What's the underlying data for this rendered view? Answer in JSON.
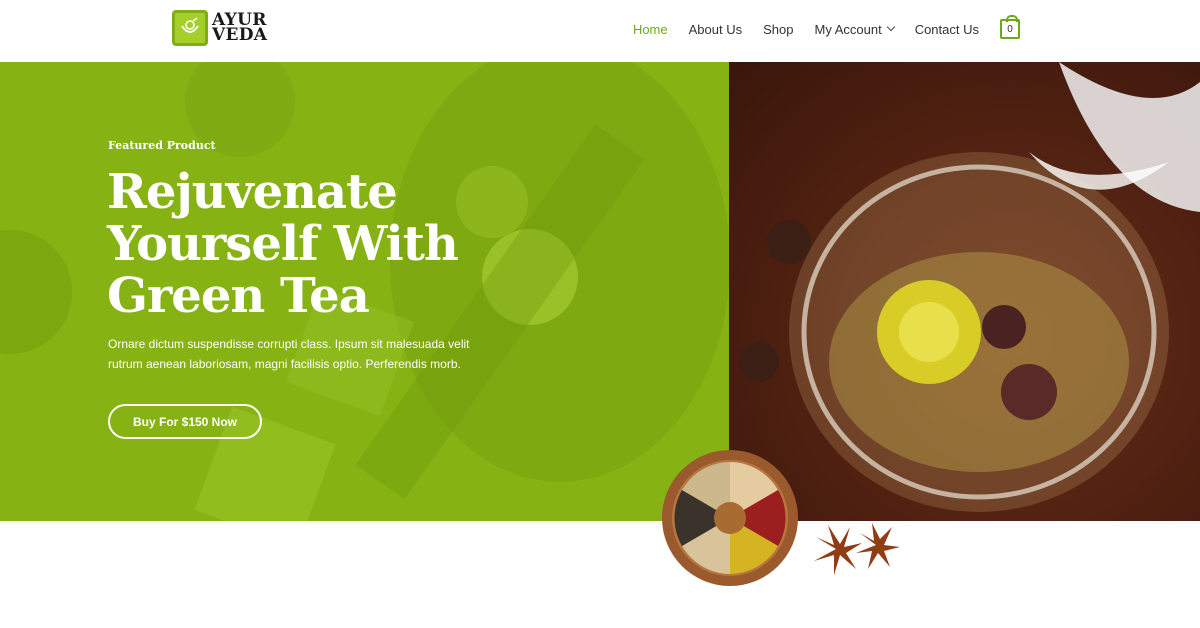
{
  "brand": {
    "logo_line1": "AYUR",
    "logo_line2": "VEDA"
  },
  "nav": {
    "items": [
      {
        "label": "Home"
      },
      {
        "label": "About Us"
      },
      {
        "label": "Shop"
      },
      {
        "label": "My Account"
      },
      {
        "label": "Contact Us"
      }
    ],
    "cart_count": "0"
  },
  "hero": {
    "eyebrow": "Featured Product",
    "headline": "Rejuvenate Yourself With Green Tea",
    "description": "Ornare dictum suspendisse corrupti class. Ipsum sit malesuada velit rutrum aenean laboriosam, magni facilisis optio. Perferendis morb.",
    "cta_label": "Buy For $150 Now"
  },
  "colors": {
    "accent_green": "#86b214",
    "nav_active": "#6fa81b",
    "white": "#ffffff"
  },
  "icons": [
    "logo-icon",
    "chevron-down-icon",
    "cart-icon"
  ]
}
